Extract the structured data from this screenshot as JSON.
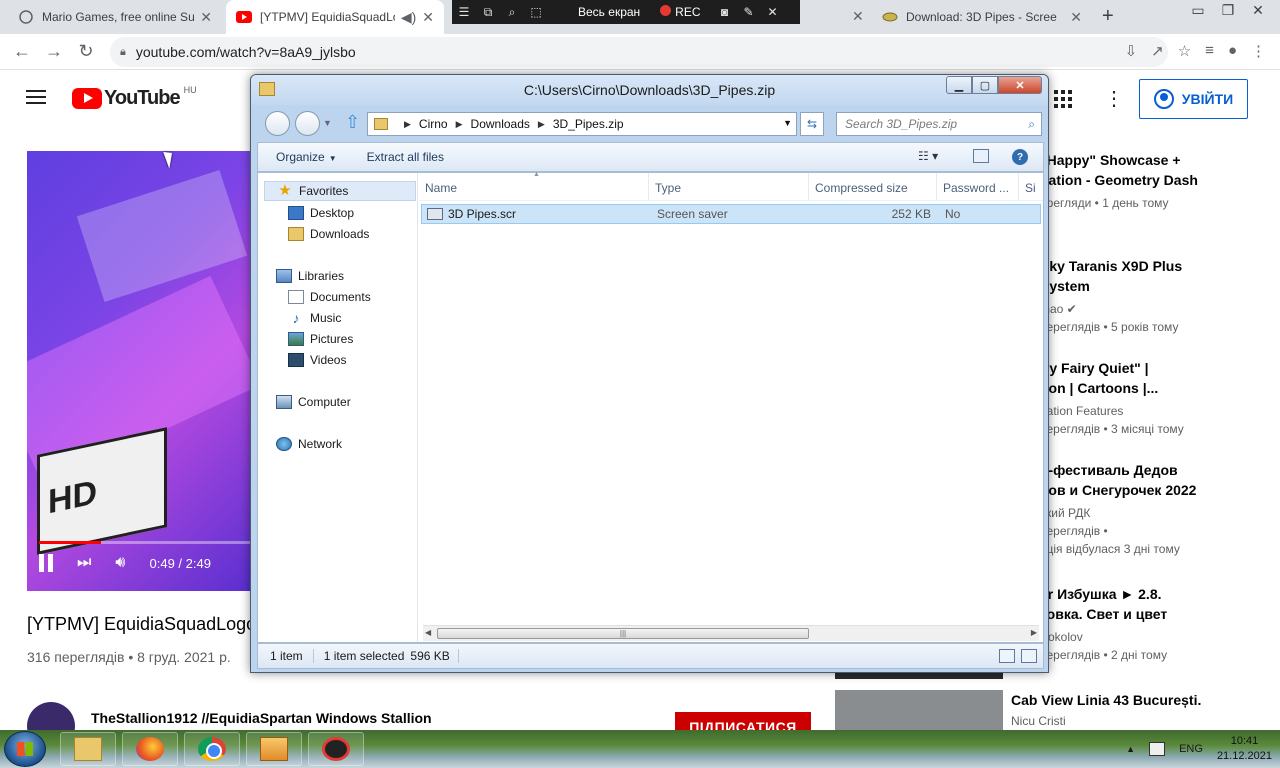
{
  "browser": {
    "tabs": [
      {
        "title": "Mario Games, free online Su",
        "active": false
      },
      {
        "title": "[YTPMV] EquidiaSquadLo",
        "active": true
      },
      {
        "title": "Download: 3D Pipes - Scree",
        "active": false
      }
    ],
    "url": "youtube.com/watch?v=8aA9_jylsbo",
    "recorder": {
      "fullscreen_label": "Весь екран",
      "rec_label": "REC"
    }
  },
  "youtube": {
    "logo_text": "YouTube",
    "country_code": "HU",
    "signin_label": "УВІЙТИ",
    "player": {
      "time": "0:49 / 2:49",
      "progress": 0.29,
      "cube_text": "HD"
    },
    "video_title": "[YTPMV] EquidiaSquadLogo",
    "video_meta": "316 переглядів • 8 груд. 2021 р.",
    "channel_name": "TheStallion1912 //EquidiaSpartan Windows Stallion",
    "subscribe_label": "ПІДПИСАТИСЯ",
    "recommendations": [
      {
        "title_l1": "\"Happy\" Showcase +",
        "title_l2": "nation - Geometry Dash",
        "channel": "",
        "views": "ерегляди • 1 день тому"
      },
      {
        "title_l1": "Sky Taranis X9D Plus",
        "title_l2": "System",
        "channel": "mao ✔",
        "views": "переглядів • 5 років тому"
      },
      {
        "title_l1": "iry Fairy Quiet\" |",
        "title_l2": "tion | Cartoons |...",
        "channel": "nation Features",
        "views": "переглядів • 3 місяці тому"
      },
      {
        "title_l1": "н-фестиваль Дедов",
        "title_l2": "вов и Снегурочек 2022",
        "channel": "ский РДК",
        "views": "переглядів •",
        "views2": "яція відбулася 3 дні тому"
      },
      {
        "title_l1": "er Избушка ► 2.8.",
        "title_l2": "товка. Свет и цвет",
        "channel": "Sokolov",
        "views": "переглядів • 2 дні тому"
      },
      {
        "title_l1": "Cab View Linia 43 București.",
        "channel": "Nicu Cristi"
      }
    ]
  },
  "explorer": {
    "title": "C:\\Users\\Cirno\\Downloads\\3D_Pipes.zip",
    "breadcrumb": [
      "Cirno",
      "Downloads",
      "3D_Pipes.zip"
    ],
    "search_placeholder": "Search 3D_Pipes.zip",
    "commands": {
      "organize": "Organize",
      "extract": "Extract all files"
    },
    "nav": {
      "favorites": "Favorites",
      "desktop": "Desktop",
      "downloads": "Downloads",
      "libraries": "Libraries",
      "documents": "Documents",
      "music": "Music",
      "pictures": "Pictures",
      "videos": "Videos",
      "computer": "Computer",
      "network": "Network"
    },
    "columns": {
      "name": "Name",
      "type": "Type",
      "size": "Compressed size",
      "password": "Password ...",
      "more": "Si"
    },
    "files": [
      {
        "name": "3D Pipes.scr",
        "type": "Screen saver",
        "size": "252 KB",
        "password": "No",
        "selected": true
      }
    ],
    "status": {
      "count": "1 item",
      "selected": "1 item selected",
      "size": "596 KB"
    }
  },
  "taskbar": {
    "language": "ENG",
    "time": "10:41",
    "date": "21.12.2021"
  }
}
